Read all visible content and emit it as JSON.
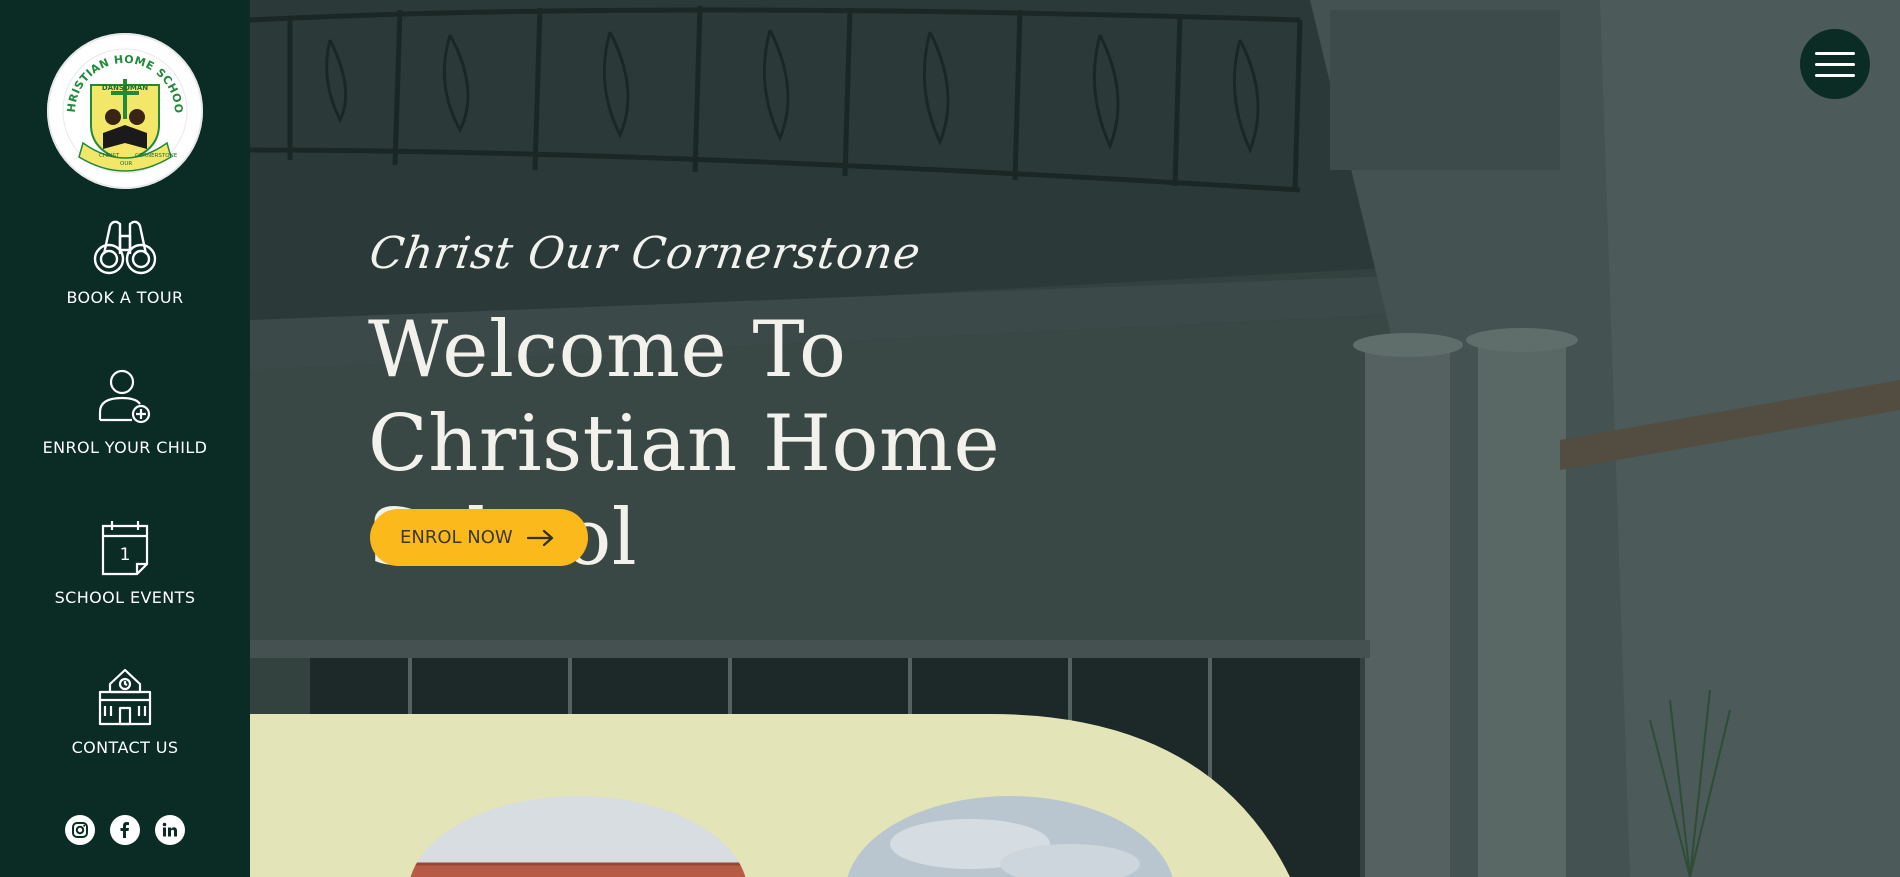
{
  "logo": {
    "name": "CHRISTIAN HOME SCHOOL",
    "location": "DANSOMAN",
    "motto_words": [
      "CHRIST",
      "OUR",
      "CORNERSTONE"
    ]
  },
  "sidebar": {
    "items": [
      {
        "label": "BOOK A TOUR",
        "icon": "binoculars-icon"
      },
      {
        "label": "ENROL YOUR CHILD",
        "icon": "add-user-icon"
      },
      {
        "label": "SCHOOL EVENTS",
        "icon": "calendar-icon",
        "calendar_day": "1"
      },
      {
        "label": "CONTACT US",
        "icon": "school-building-icon"
      }
    ],
    "socials": [
      "instagram-icon",
      "facebook-icon",
      "linkedin-icon"
    ]
  },
  "hero": {
    "tagline": "Christ Our Cornerstone",
    "title_line1": "Welcome To",
    "title_line2": "Christian Home School",
    "cta_label": "ENROL NOW"
  },
  "menu": {
    "icon": "hamburger-icon"
  },
  "colors": {
    "sidebar": "#0b2b25",
    "accent": "#fbb91b",
    "panel": "#e3e4b8"
  }
}
